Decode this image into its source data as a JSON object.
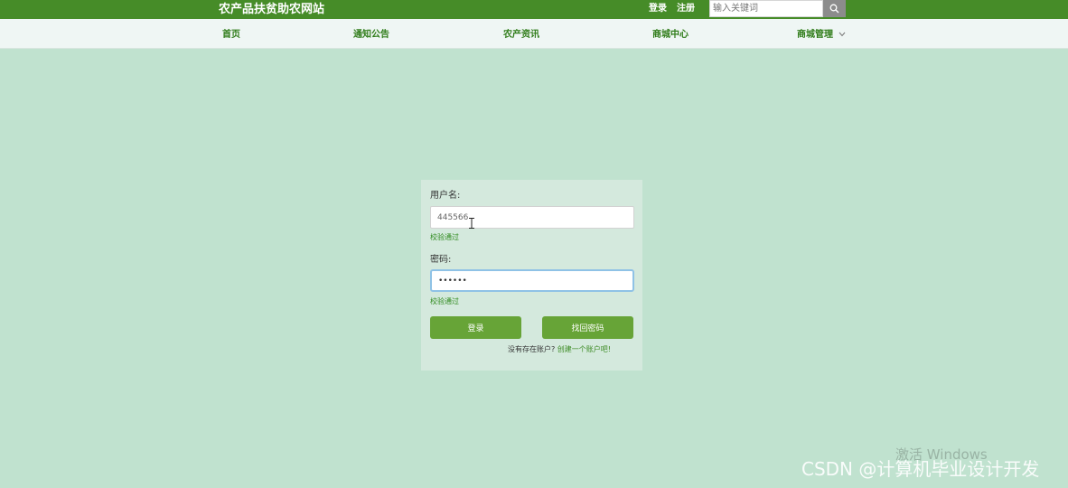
{
  "header": {
    "site_title": "农产品扶贫助农网站",
    "login_link": "登录",
    "register_link": "注册",
    "search_placeholder": "输入关键词",
    "search_icon": "search-icon"
  },
  "nav": {
    "items": [
      {
        "label": "首页"
      },
      {
        "label": "通知公告"
      },
      {
        "label": "农产资讯"
      },
      {
        "label": "商城中心"
      },
      {
        "label": "商城管理"
      }
    ]
  },
  "login_form": {
    "username_label": "用户名:",
    "username_value": "445566",
    "username_hint": "校验通过",
    "password_label": "密码:",
    "password_value": "123456",
    "password_hint": "校验通过",
    "login_button": "登录",
    "forgot_button": "找回密码",
    "no_account_text": "没有存在账户?",
    "create_account_link": "创建一个账户吧!"
  },
  "watermarks": {
    "windows": "激活 Windows",
    "csdn": "CSDN @计算机毕业设计开发"
  },
  "colors": {
    "header_bg": "#468c28",
    "page_bg": "#c0e2cf",
    "button_bg": "#67a437",
    "accent_text": "#2f7c19"
  }
}
